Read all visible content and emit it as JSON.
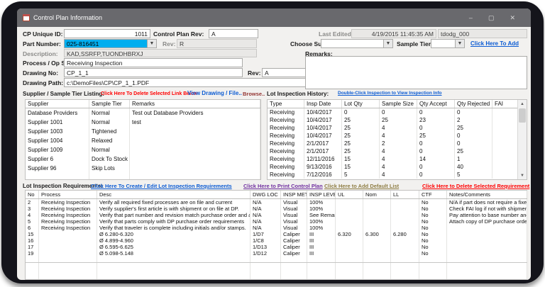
{
  "window": {
    "title": "Control Plan Information",
    "controls": {
      "minimize": "–",
      "maximize": "▢",
      "close": "✕"
    }
  },
  "form": {
    "cp_id_label": "CP Unique ID:",
    "cp_id": "1011",
    "cprev_label": "Control Plan Rev:",
    "cprev": "A",
    "last_edited_label": "Last Edited:",
    "last_edited": "4/19/2015 11:45:35 AM",
    "edited_by": "tdodg_000",
    "part_label": "Part Number:",
    "part_value": "025-816451",
    "part_rev_label": "Rev:",
    "part_rev": "R",
    "desc_label": "Description:",
    "desc_value": "KAD,SSRFP,TUONDHBRXJ",
    "process_label": "Process / Op Step:",
    "process_value": "Receiving Inspection",
    "dwg_no_label": "Drawing No:",
    "dwg_no": "CP_1_1",
    "dwg_rev_label": "Rev:",
    "dwg_rev": "A",
    "path_label": "Drawing Path:",
    "path_value": "c:\\DemoFiles\\CP\\CP_1_1.PDF"
  },
  "addpanel": {
    "choose_label": "Choose Supplier",
    "tier_label": "Sample Tier",
    "add_link": "Click Here To Add",
    "remarks_label": "Remarks:",
    "remarks_value": ""
  },
  "suppliers": {
    "title": "Supplier / Sample Tier Listing:",
    "delete_link": "Click Here To Delete Selected Link Below",
    "view_link": "View Drawing / File..",
    "browse_link": "Browse..",
    "columns": [
      "Supplier",
      "Sample Tier",
      "Remarks"
    ],
    "rows": [
      [
        "Database Providers",
        "Normal",
        "Test out Database Providers"
      ],
      [
        "Supplier 1001",
        "Normal",
        "test"
      ],
      [
        "Supplier 1003",
        "Tightened",
        ""
      ],
      [
        "Supplier 1004",
        "Relaxed",
        ""
      ],
      [
        "Supplier 1009",
        "Normal",
        ""
      ],
      [
        "Supplier 6",
        "Dock To Stock",
        ""
      ],
      [
        "Supplier 96",
        "Skip Lots",
        ""
      ]
    ]
  },
  "history": {
    "title": "Lot Inspection History:",
    "hint": "Double-Click Inspection to View Inspection Info",
    "columns": [
      "Type",
      "Insp Date",
      "Lot Qty",
      "Sample Size",
      "Qty Accept",
      "Qty Rejected",
      "FAI"
    ],
    "rows": [
      [
        "Receiving",
        "10/4/2017",
        "0",
        "0",
        "0",
        "0",
        ""
      ],
      [
        "Receiving",
        "10/4/2017",
        "25",
        "25",
        "23",
        "2",
        ""
      ],
      [
        "Receiving",
        "10/4/2017",
        "25",
        "4",
        "0",
        "25",
        ""
      ],
      [
        "Receiving",
        "10/4/2017",
        "25",
        "4",
        "25",
        "0",
        ""
      ],
      [
        "Receiving",
        "2/1/2017",
        "25",
        "2",
        "0",
        "0",
        ""
      ],
      [
        "Receiving",
        "2/1/2017",
        "25",
        "4",
        "0",
        "25",
        ""
      ],
      [
        "Receiving",
        "12/11/2016",
        "15",
        "4",
        "14",
        "1",
        ""
      ],
      [
        "Receiving",
        "9/13/2016",
        "15",
        "4",
        "0",
        "40",
        ""
      ],
      [
        "Receiving",
        "7/12/2016",
        "5",
        "4",
        "0",
        "5",
        ""
      ]
    ]
  },
  "reqs": {
    "title": "Lot Inspection Requirements:",
    "create_link": "Click Here To Create / Edit Lot Inspection Requirements",
    "print_link": "Click Here to Print Control Plan",
    "defaults_link": "Click Here to Add Default List",
    "delete_link": "Click Here to Delete Selected Requirement",
    "columns": [
      "No",
      "Process",
      "Desc",
      "DWG LOC",
      "INSP METHOD",
      "INSP LEVEL",
      "UL",
      "Nom",
      "LL",
      "CTF",
      "Notes/Comments"
    ],
    "rows": [
      [
        "2",
        "Receiving Inspection",
        "Verify all required fixed processes are on file and current",
        "N/A",
        "Visual",
        "100%",
        "",
        "",
        "",
        "No",
        "N/A if part does not require a fixed p"
      ],
      [
        "3",
        "Receiving Inspection",
        "Verify supplier's first article is with shipment or on file at DP.",
        "N/A",
        "Visual",
        "100%",
        "",
        "",
        "",
        "No",
        "Check FAI log if not with shipment.  I"
      ],
      [
        "4",
        "Receiving Inspection",
        "Verify that part number and revision match purchase order and appro",
        "N/A",
        "Visual",
        "See Remarks",
        "",
        "",
        "",
        "No",
        "Pay attention to base number and th"
      ],
      [
        "5",
        "Receiving Inspection",
        "Verify that parts comply with DP purchase order requirements",
        "N/A",
        "Visual",
        "100%",
        "",
        "",
        "",
        "No",
        "Attach copy of DP purchase order"
      ],
      [
        "6",
        "Receiving Inspection",
        "Verify that traveler is complete including initials and/or stamps.",
        "N/A",
        "Visual",
        "100%",
        "",
        "",
        "",
        "No",
        ""
      ],
      [
        "15",
        "",
        "Ø 6.280-6.320",
        "1/D7",
        "Caliper",
        "III",
        "6.320",
        "6.300",
        "6.280",
        "No",
        ""
      ],
      [
        "16",
        "",
        "Ø 4.899-4.960",
        "1/C8",
        "Caliper",
        "III",
        "",
        "",
        "",
        "No",
        ""
      ],
      [
        "17",
        "",
        "Ø 6.595-6.625",
        "1/D13",
        "Caliper",
        "III",
        "",
        "",
        "",
        "No",
        ""
      ],
      [
        "19",
        "",
        "Ø 5.098-5.148",
        "1/D12",
        "Caliper",
        "III",
        "",
        "",
        "",
        "No",
        ""
      ]
    ]
  }
}
